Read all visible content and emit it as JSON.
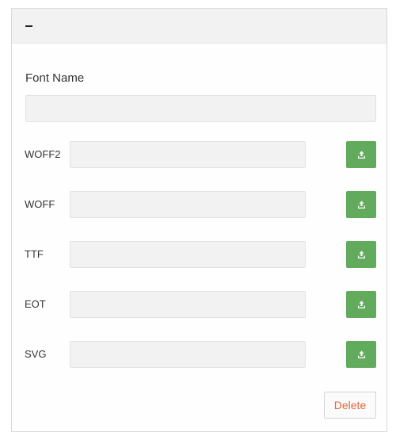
{
  "header": {
    "toggle_icon": "minus-icon"
  },
  "form": {
    "font_name_label": "Font Name",
    "font_name_value": "",
    "font_name_placeholder": "",
    "files": [
      {
        "label": "WOFF2",
        "value": "",
        "upload_icon": "upload-icon"
      },
      {
        "label": "WOFF",
        "value": "",
        "upload_icon": "upload-icon"
      },
      {
        "label": "TTF",
        "value": "",
        "upload_icon": "upload-icon"
      },
      {
        "label": "EOT",
        "value": "",
        "upload_icon": "upload-icon"
      },
      {
        "label": "SVG",
        "value": "",
        "upload_icon": "upload-icon"
      }
    ],
    "delete_label": "Delete"
  },
  "colors": {
    "upload_button": "#62ab5c",
    "delete_text": "#e2673e",
    "input_background": "#f2f2f2",
    "header_background": "#f2f2f2"
  }
}
